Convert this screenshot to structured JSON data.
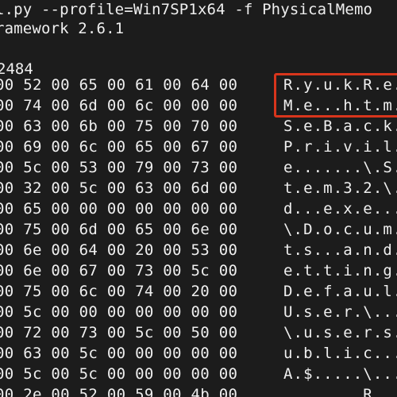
{
  "terminal": {
    "command_line": "l.py --profile=Win7SP1x64 -f PhysicalMemo",
    "framework_line": "ramework 2.6.1",
    "pid_line": "2484",
    "highlight_color": "#d8351c",
    "rows": [
      {
        "hex": "00 52 00 65 00 61 00 64 00",
        "ascii": "R.y.u.k.R.e."
      },
      {
        "hex": "00 74 00 6d 00 6c 00 00 00",
        "ascii": "M.e...h.t.m."
      },
      {
        "hex": "00 63 00 6b 00 75 00 70 00",
        "ascii": "S.e.B.a.c.k."
      },
      {
        "hex": "00 69 00 6c 00 65 00 67 00",
        "ascii": "P.r.i.v.i.l."
      },
      {
        "hex": "00 5c 00 53 00 79 00 73 00",
        "ascii": "e.......\\.S."
      },
      {
        "hex": "00 32 00 5c 00 63 00 6d 00",
        "ascii": "t.e.m.3.2.\\."
      },
      {
        "hex": "00 65 00 00 00 00 00 00 00",
        "ascii": "d...e.x.e..."
      },
      {
        "hex": "00 75 00 6d 00 65 00 6e 00",
        "ascii": "\\.D.o.c.u.m."
      },
      {
        "hex": "00 6e 00 64 00 20 00 53 00",
        "ascii": "t.s...a.n.d."
      },
      {
        "hex": "00 6e 00 67 00 73 00 5c 00",
        "ascii": "e.t.t.i.n.g."
      },
      {
        "hex": "00 75 00 6c 00 74 00 20 00",
        "ascii": "D.e.f.a.u.l."
      },
      {
        "hex": "00 5c 00 00 00 00 00 00 00",
        "ascii": "U.s.e.r.\\..."
      },
      {
        "hex": "00 72 00 73 00 5c 00 50 00",
        "ascii": "\\.u.s.e.r.s."
      },
      {
        "hex": "00 63 00 5c 00 00 00 00 00",
        "ascii": "u.b.l.i.c..."
      },
      {
        "hex": "00 5c 00 5c 00 00 00 00 00",
        "ascii": "A.$.....\\..."
      },
      {
        "hex": "00 2e 00 52 00 59 00 4b 00",
        "ascii": "........R..."
      }
    ]
  }
}
